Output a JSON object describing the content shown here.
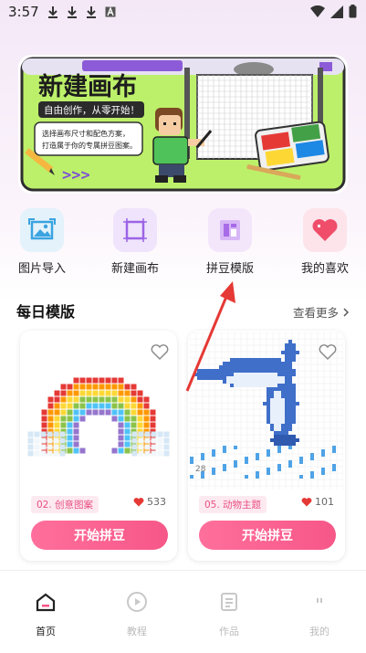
{
  "status": {
    "time": "3:57",
    "right_icons": [
      "wifi-icon",
      "signal-icon",
      "battery-icon"
    ]
  },
  "banner": {
    "title": "新建画布",
    "subtitle": "自由创作，从零开始！",
    "description_line1": "选择画布尺寸和配色方案，",
    "description_line2": "打造属于你的专属拼豆图案。",
    "arrows": ">>>"
  },
  "quick_actions": [
    {
      "label": "图片导入",
      "icon": "image-import-icon"
    },
    {
      "label": "新建画布",
      "icon": "new-canvas-icon"
    },
    {
      "label": "拼豆模版",
      "icon": "template-icon"
    },
    {
      "label": "我的喜欢",
      "icon": "heart-icon"
    }
  ],
  "daily": {
    "title": "每日模版",
    "more": "查看更多"
  },
  "cards": [
    {
      "tag": "02. 创意图案",
      "likes": "533",
      "button": "开始拼豆",
      "image": "rainbow-pixel-art"
    },
    {
      "tag": "05. 动物主题",
      "likes": "101",
      "button": "开始拼豆",
      "image": "dolphin-pixel-art",
      "number_left": "28"
    }
  ],
  "nav": [
    {
      "label": "首页",
      "icon": "home-icon",
      "active": true
    },
    {
      "label": "教程",
      "icon": "play-icon",
      "active": false
    },
    {
      "label": "作品",
      "icon": "works-icon",
      "active": false
    },
    {
      "label": "我的",
      "icon": "profile-icon",
      "active": false
    }
  ],
  "colors": {
    "accent": "#f65788",
    "tag_bg": "#fdeaf1",
    "banner_green": "#c8f26b",
    "arrow_red": "#e53935"
  }
}
